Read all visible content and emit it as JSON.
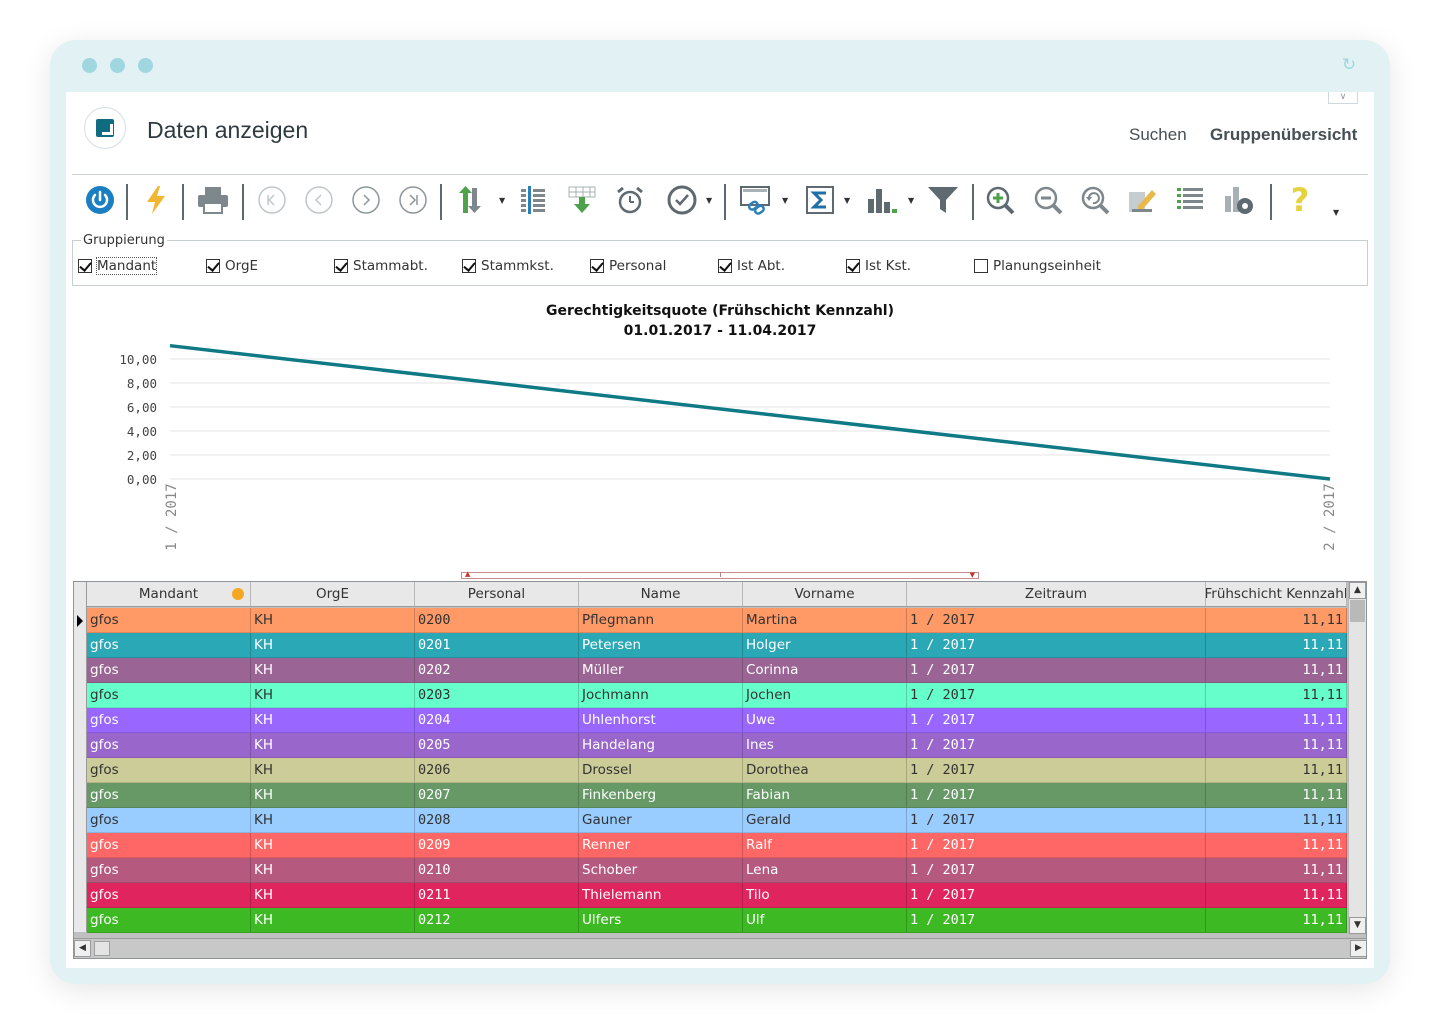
{
  "header": {
    "title": "Daten anzeigen",
    "links": [
      "Suchen",
      "Gruppenübersicht"
    ]
  },
  "toolbar": {
    "icons": [
      "power-icon",
      "lightning-icon",
      "print-icon",
      "first-icon",
      "prev-icon",
      "next-icon",
      "last-icon",
      "sort-icon",
      "columns-icon",
      "export-icon",
      "alarm-icon",
      "clock-check-icon",
      "link-display-icon",
      "sum-icon",
      "bar-chart-icon",
      "filter-icon",
      "zoom-in-icon",
      "zoom-out-icon",
      "zoom-reset-icon",
      "edit-icon",
      "list-icon",
      "settings-icon",
      "help-icon"
    ]
  },
  "grouping": {
    "legend": "Gruppierung",
    "options": [
      {
        "label": "Mandant",
        "checked": true
      },
      {
        "label": "OrgE",
        "checked": true
      },
      {
        "label": "Stammabt.",
        "checked": true
      },
      {
        "label": "Stammkst.",
        "checked": true
      },
      {
        "label": "Personal",
        "checked": true
      },
      {
        "label": "Ist Abt.",
        "checked": true
      },
      {
        "label": "Ist Kst.",
        "checked": true
      },
      {
        "label": "Planungseinheit",
        "checked": false
      }
    ]
  },
  "chart_data": {
    "type": "line",
    "title": "Gerechtigkeitsquote (Frühschicht Kennzahl)",
    "subtitle": "01.01.2017 - 11.04.2017",
    "categories": [
      "1 / 2017",
      "2 / 2017"
    ],
    "series": [
      {
        "values": [
          11.11,
          0.0
        ],
        "color": "#0f7a86"
      }
    ],
    "yticks": [
      "0,00",
      "2,00",
      "4,00",
      "6,00",
      "8,00",
      "10,00"
    ],
    "ylim": [
      0,
      10
    ],
    "grid": true
  },
  "table": {
    "columns": [
      "Mandant",
      "OrgE",
      "Personal",
      "Name",
      "Vorname",
      "Zeitraum",
      "Frühschicht Kennzahl"
    ],
    "rows": [
      {
        "cells": [
          "gfos",
          "KH",
          "0200",
          "Pflegmann",
          "Martina",
          "1 / 2017",
          "11,11"
        ],
        "bg": "#ff9966",
        "fg": "#333333"
      },
      {
        "cells": [
          "gfos",
          "KH",
          "0201",
          "Petersen",
          "Holger",
          "1 / 2017",
          "11,11"
        ],
        "bg": "#2aa8b5",
        "fg": "#ffffff"
      },
      {
        "cells": [
          "gfos",
          "KH",
          "0202",
          "Müller",
          "Corinna",
          "1 / 2017",
          "11,11"
        ],
        "bg": "#9a6594",
        "fg": "#ffffff"
      },
      {
        "cells": [
          "gfos",
          "KH",
          "0203",
          "Jochmann",
          "Jochen",
          "1 / 2017",
          "11,11"
        ],
        "bg": "#66ffcc",
        "fg": "#333333"
      },
      {
        "cells": [
          "gfos",
          "KH",
          "0204",
          "Uhlenhorst",
          "Uwe",
          "1 / 2017",
          "11,11"
        ],
        "bg": "#9966ff",
        "fg": "#ffffff"
      },
      {
        "cells": [
          "gfos",
          "KH",
          "0205",
          "Handelang",
          "Ines",
          "1 / 2017",
          "11,11"
        ],
        "bg": "#9966cc",
        "fg": "#ffffff"
      },
      {
        "cells": [
          "gfos",
          "KH",
          "0206",
          "Drossel",
          "Dorothea",
          "1 / 2017",
          "11,11"
        ],
        "bg": "#cccc99",
        "fg": "#333333"
      },
      {
        "cells": [
          "gfos",
          "KH",
          "0207",
          "Finkenberg",
          "Fabian",
          "1 / 2017",
          "11,11"
        ],
        "bg": "#669966",
        "fg": "#ffffff"
      },
      {
        "cells": [
          "gfos",
          "KH",
          "0208",
          "Gauner",
          "Gerald",
          "1 / 2017",
          "11,11"
        ],
        "bg": "#99ccff",
        "fg": "#333333"
      },
      {
        "cells": [
          "gfos",
          "KH",
          "0209",
          "Renner",
          "Ralf",
          "1 / 2017",
          "11,11"
        ],
        "bg": "#ff6666",
        "fg": "#ffffff"
      },
      {
        "cells": [
          "gfos",
          "KH",
          "0210",
          "Schober",
          "Lena",
          "1 / 2017",
          "11,11"
        ],
        "bg": "#b55a7e",
        "fg": "#ffffff"
      },
      {
        "cells": [
          "gfos",
          "KH",
          "0211",
          "Thielemann",
          "Tilo",
          "1 / 2017",
          "11,11"
        ],
        "bg": "#e0245e",
        "fg": "#ffffff"
      },
      {
        "cells": [
          "gfos",
          "KH",
          "0212",
          "Ulfers",
          "Ulf",
          "1 / 2017",
          "11,11"
        ],
        "bg": "#3dba23",
        "fg": "#ffffff"
      }
    ]
  },
  "colors": {
    "accent": "#0e6b80",
    "frame": "#e1f1f4",
    "dots": "#9fd6df",
    "sort_badge": "#f5a623"
  }
}
